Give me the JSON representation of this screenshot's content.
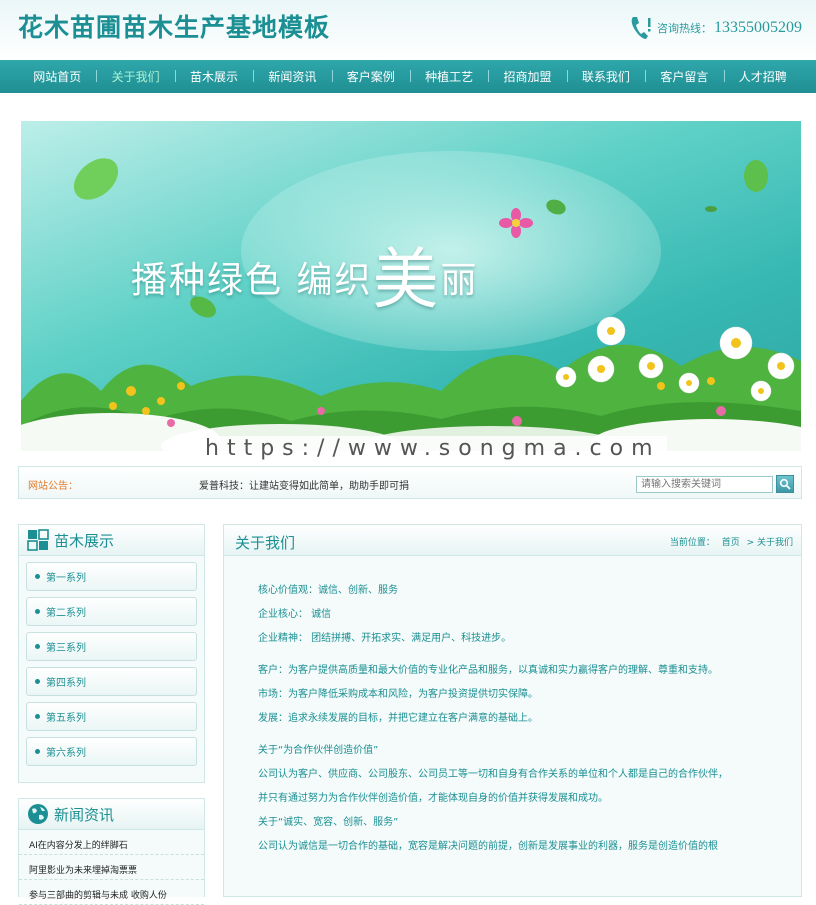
{
  "header": {
    "site_title": "花木苗圃苗木生产基地模板",
    "hotline_label": "咨询热线：",
    "hotline_number": "13355005209"
  },
  "nav": {
    "items": [
      "网站首页",
      "关于我们",
      "苗木展示",
      "新闻资讯",
      "客户案例",
      "种植工艺",
      "招商加盟",
      "联系我们",
      "客户留言",
      "人才招聘"
    ],
    "active": "关于我们"
  },
  "banner": {
    "slogan_a": "播种绿色",
    "slogan_b": "编织",
    "slogan_big": "美",
    "slogan_c": "丽"
  },
  "watermark": "https://www.songma.com",
  "notice": {
    "label": "网站公告：",
    "text": "爱普科技：让建站变得如此简单，助助手即可捐",
    "search_placeholder": "请输入搜索关键词"
  },
  "sidebar": {
    "products_title": "苗木展示",
    "categories": [
      "第一系列",
      "第二系列",
      "第三系列",
      "第四系列",
      "第五系列",
      "第六系列"
    ],
    "news_title": "新闻资讯",
    "news": [
      "AI在内容分发上的绊脚石",
      "阿里影业为未来埋掉淘票票",
      "参与三部曲的剪辑与未成 收购人份"
    ]
  },
  "main": {
    "title": "关于我们",
    "breadcrumb_label": "当前位置：",
    "breadcrumb_home": "首页",
    "breadcrumb_current": "> 关于我们",
    "lines": [
      "核心价值观：诚信、创新、服务",
      "企业核心：  诚信",
      "企业精神：  团结拼搏、开拓求实、满足用户、科技进步。",
      "",
      "客户：为客户提供高质量和最大价值的专业化产品和服务，以真诚和实力赢得客户的理解、尊重和支持。",
      "市场：为客户降低采购成本和风险，为客户投资提供切实保障。",
      "发展：追求永续发展的目标，并把它建立在客户满意的基础上。",
      "",
      "关于“为合作伙伴创造价值”",
      "公司认为客户、供应商、公司股东、公司员工等一切和自身有合作关系的单位和个人都是自己的合作伙伴，",
      "并只有通过努力为合作伙伴创造价值，才能体现自身的价值并获得发展和成功。",
      "关于“诚实、宽容、创新、服务”",
      "公司认为诚信是一切合作的基础，宽容是解决问题的前提，创新是发展事业的利器，服务是创造价值的根"
    ]
  }
}
